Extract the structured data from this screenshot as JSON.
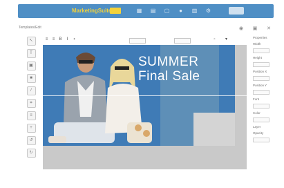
{
  "app": {
    "brand_name": "MarketingSuite",
    "brand_color": "#f4d23a",
    "topbar_color": "#4f8fc5"
  },
  "breadcrumb": "Templates/Edit",
  "top_nav_icons": [
    "dashboard-icon",
    "grid-icon",
    "folder-icon",
    "user-icon",
    "stats-icon",
    "settings-icon"
  ],
  "editor_toolbar_icons": [
    "align-left-icon",
    "align-center-icon",
    "bold-icon",
    "italic-icon",
    "image-icon"
  ],
  "canvas": {
    "headline_line1": "SUMMER",
    "headline_line2": "Final Sale",
    "banner_color": "#3f7bb6"
  },
  "left_tools": [
    "select-tool",
    "text-tool",
    "image-tool",
    "shape-tool",
    "line-tool",
    "crop-tool",
    "layers-tool",
    "zoom-tool",
    "undo-tool",
    "redo-tool"
  ],
  "right_panel": {
    "labels": [
      "Properties",
      "Width",
      "Height",
      "Position X",
      "Position Y",
      "Font",
      "Color",
      "Layer",
      "Opacity"
    ]
  }
}
